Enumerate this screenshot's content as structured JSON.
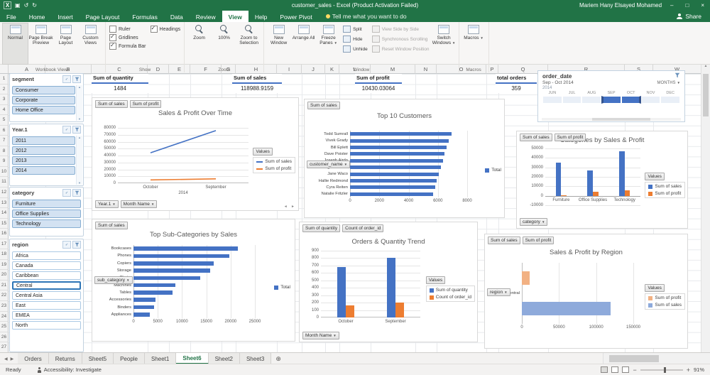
{
  "title_bar": {
    "app_title": "customer_sales  -  Excel (Product Activation Failed)",
    "user": "Mariem Hany Elsayed Mohamed"
  },
  "tabs": {
    "items": [
      "File",
      "Home",
      "Insert",
      "Page Layout",
      "Formulas",
      "Data",
      "Review",
      "View",
      "Help",
      "Power Pivot"
    ],
    "active": "View",
    "tell_me": "Tell me what you want to do",
    "share": "Share"
  },
  "ribbon": {
    "workbook_views": {
      "group": "Workbook Views",
      "normal": "Normal",
      "page_break": "Page Break Preview",
      "page_layout": "Page Layout",
      "custom_views": "Custom Views"
    },
    "show": {
      "group": "Show",
      "ruler": "Ruler",
      "gridlines": "Gridlines",
      "formula_bar": "Formula Bar",
      "headings": "Headings",
      "ruler_checked": false,
      "gridlines_checked": true,
      "formula_bar_checked": true,
      "headings_checked": true
    },
    "zoom": {
      "group": "Zoom",
      "zoom": "Zoom",
      "pct": "100%",
      "zoom_sel": "Zoom to Selection"
    },
    "window": {
      "group": "Window",
      "new_window": "New Window",
      "arrange_all": "Arrange All",
      "freeze_panes": "Freeze Panes",
      "split": "Split",
      "hide": "Hide",
      "unhide": "Unhide",
      "side_by_side": "View Side by Side",
      "sync_scroll": "Synchronous Scrolling",
      "reset_pos": "Reset Window Position",
      "switch_windows": "Switch Windows"
    },
    "macros": {
      "group": "Macros",
      "macros": "Macros"
    }
  },
  "sheet": {
    "columns": [
      "A",
      "B",
      "C",
      "D",
      "E",
      "F",
      "G",
      "H",
      "I",
      "J",
      "K",
      "L",
      "M",
      "N",
      "O",
      "P",
      "Q",
      "R",
      "S",
      "W"
    ],
    "rows": 27
  },
  "pivot_values": [
    {
      "label": "Sum of quantity",
      "value": "1484"
    },
    {
      "label": "Sum of sales",
      "value": "118988.9159"
    },
    {
      "label": "Sum of profit",
      "value": "10430.03064"
    },
    {
      "label": "total orders",
      "value": "359"
    }
  ],
  "slicers": [
    {
      "title": "segment",
      "items": [
        "Consumer",
        "Corporate",
        "Home Office"
      ],
      "selected": [
        "Consumer",
        "Corporate",
        "Home Office"
      ],
      "scroll": true
    },
    {
      "title": "Year.1",
      "items": [
        "2011",
        "2012",
        "2013",
        "2014"
      ],
      "selected": [
        "2011",
        "2012",
        "2013",
        "2014"
      ],
      "scroll": true
    },
    {
      "title": "category",
      "items": [
        "Furniture",
        "Office Supplies",
        "Technology"
      ],
      "selected": [
        "Furniture",
        "Office Supplies",
        "Technology"
      ],
      "scroll": false
    },
    {
      "title": "region",
      "items": [
        "Africa",
        "Canada",
        "Caribbean",
        "Central",
        "Central Asia",
        "East",
        "EMEA",
        "North"
      ],
      "selected": [],
      "focused": "Central",
      "scroll": false
    }
  ],
  "timeline": {
    "title": "order_date",
    "range_label": "Sep - Oct 2014",
    "period_label": "MONTHS",
    "year": "2014",
    "months": [
      "JUN",
      "JUL",
      "AUG",
      "SEP",
      "OCT",
      "NOV",
      "DEC"
    ],
    "selected": [
      "SEP",
      "OCT"
    ]
  },
  "charts": [
    {
      "type": "line",
      "title": "Sales & Profit Over Time",
      "top_buttons": [
        "Sum of sales",
        "Sum of profit"
      ],
      "bottom_buttons": [
        "Year.1",
        "Month Name"
      ],
      "categories": [
        "October",
        "September"
      ],
      "group_label": "2014",
      "series": [
        {
          "name": "Sum of sales",
          "color": "#4472c4",
          "values": [
            44000,
            76000
          ]
        },
        {
          "name": "Sum of profit",
          "color": "#ed7d31",
          "values": [
            4800,
            6300
          ]
        }
      ],
      "ylim": [
        0,
        80000
      ],
      "ytick_step": 10000,
      "legend_title": "Values"
    },
    {
      "type": "hbar",
      "title": "Top 10 Customers",
      "top_buttons": [
        "Sum of sales"
      ],
      "left_button": "customer_name",
      "categories": [
        "Todd Sumrall",
        "Vivek Grady",
        "Bill Eplett",
        "Dave Poister",
        "Joseph Airdo",
        "Meg O'Connel",
        "Jane Waco",
        "Hallie Redmond",
        "Cyra Reiten",
        "Natalie Fritzler"
      ],
      "values": [
        6911,
        6760,
        6610,
        6470,
        6330,
        6190,
        6060,
        5930,
        5800,
        5670
      ],
      "xlim": [
        0,
        8000
      ],
      "xticks": [
        0,
        2000,
        4000,
        6000,
        8000
      ],
      "legend": [
        {
          "name": "Total",
          "color": "#4472c4"
        }
      ]
    },
    {
      "type": "vbar",
      "title": "Categories by Sales & Profit",
      "top_buttons": [
        "Sum of sales",
        "Sum of profit"
      ],
      "bottom_buttons": [
        "category"
      ],
      "categories": [
        "Furniture",
        "Office Supplies",
        "Technology"
      ],
      "series": [
        {
          "name": "Sum of sales",
          "color": "#4472c4",
          "values": [
            35000,
            27000,
            47000
          ]
        },
        {
          "name": "Sum of profit",
          "color": "#ed7d31",
          "values": [
            800,
            4200,
            5700
          ]
        }
      ],
      "ylim": [
        -10000,
        50000
      ],
      "ytick_step": 10000,
      "legend_title": "Values",
      "labels_at_zero": true
    },
    {
      "type": "hbar",
      "title": "Top Sub-Categories by Sales",
      "top_buttons": [
        "Sum of sales"
      ],
      "left_button": "sub_category",
      "categories": [
        "Bookcases",
        "Phones",
        "Copiers",
        "Storage",
        "Chairs",
        "Machines",
        "Tables",
        "Accessories",
        "Binders",
        "Appliances"
      ],
      "values": [
        21500,
        19800,
        16500,
        15800,
        13800,
        8600,
        8000,
        4600,
        4200,
        3400
      ],
      "xlim": [
        0,
        25000
      ],
      "xticks": [
        0,
        5000,
        10000,
        15000,
        20000,
        25000
      ],
      "legend": [
        {
          "name": "Total",
          "color": "#4472c4"
        }
      ]
    },
    {
      "type": "vbar",
      "title": "Orders & Quantity Trend",
      "top_buttons": [
        "Sum of quantity",
        "Count of order_id"
      ],
      "bottom_buttons": [
        "Month Name"
      ],
      "categories": [
        "October",
        "September"
      ],
      "series": [
        {
          "name": "Sum of quantity",
          "color": "#4472c4",
          "values": [
            680,
            800
          ]
        },
        {
          "name": "Count of order_id",
          "color": "#ed7d31",
          "values": [
            160,
            200
          ]
        }
      ],
      "ylim": [
        0,
        900
      ],
      "ytick_step": 100,
      "legend_title": "Values"
    },
    {
      "type": "hbar2",
      "title": "Sales & Profit by Region",
      "top_buttons": [
        "Sum of sales",
        "Sum of profit"
      ],
      "left_button": "region",
      "categories": [
        "Central"
      ],
      "series": [
        {
          "name": "Sum of profit",
          "color": "#f2b183",
          "values": [
            10430
          ]
        },
        {
          "name": "Sum of sales",
          "color": "#8eaadb",
          "values": [
            118989
          ]
        }
      ],
      "xlim": [
        0,
        150000
      ],
      "xticks": [
        0,
        50000,
        100000,
        150000
      ],
      "legend_title": "Values"
    }
  ],
  "sheet_tabs": {
    "items": [
      "Orders",
      "Returns",
      "Sheet5",
      "People",
      "Sheet1",
      "Sheet6",
      "Sheet2",
      "Sheet3"
    ],
    "active": "Sheet6"
  },
  "status_bar": {
    "ready": "Ready",
    "accessibility": "Accessibility: Investigate",
    "zoom": "91%"
  }
}
